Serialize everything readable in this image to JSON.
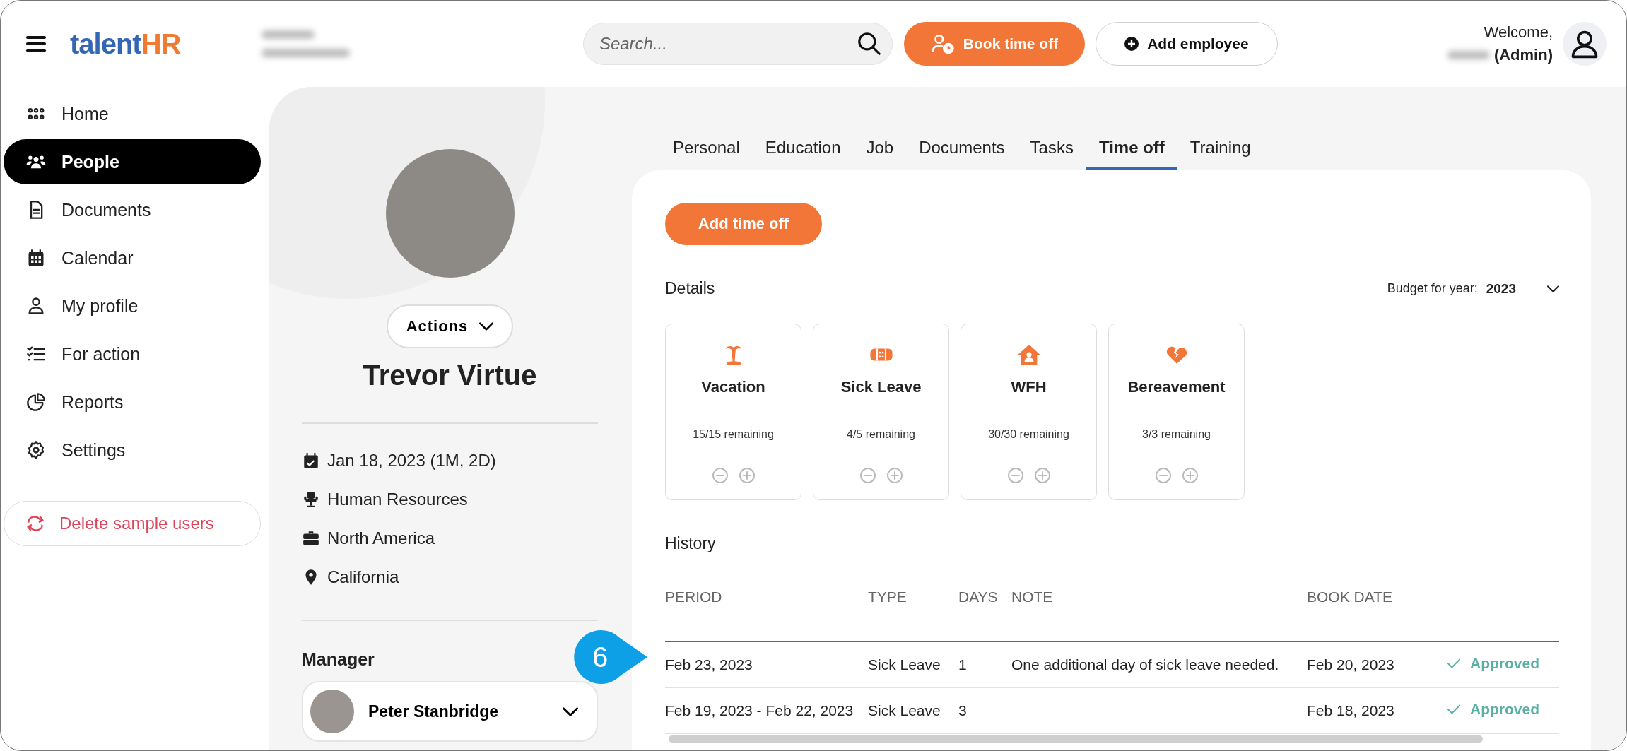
{
  "header": {
    "logo": {
      "part_1": "talent",
      "part_2": "HR"
    },
    "search": {
      "placeholder": "Search..."
    },
    "book_button": "Book time off",
    "add_button": "Add employee",
    "welcome": "Welcome,",
    "role": "(Admin)"
  },
  "sidebar": {
    "items": [
      {
        "label": "Home",
        "selected": false
      },
      {
        "label": "People",
        "selected": true
      },
      {
        "label": "Documents",
        "selected": false
      },
      {
        "label": "Calendar",
        "selected": false
      },
      {
        "label": "My profile",
        "selected": false
      },
      {
        "label": "For action",
        "selected": false
      },
      {
        "label": "Reports",
        "selected": false
      },
      {
        "label": "Settings",
        "selected": false
      }
    ],
    "delete_button": "Delete sample users"
  },
  "profile": {
    "actions_button": "Actions",
    "name": "Trevor Virtue",
    "facts": [
      {
        "text": "Jan 18, 2023 (1M, 2D)"
      },
      {
        "text": "Human Resources"
      },
      {
        "text": "North America"
      },
      {
        "text": "California"
      }
    ],
    "manager_heading": "Manager",
    "manager": "Peter Stanbridge"
  },
  "tabs": [
    {
      "label": "Personal",
      "selected": false
    },
    {
      "label": "Education",
      "selected": false
    },
    {
      "label": "Job",
      "selected": false
    },
    {
      "label": "Documents",
      "selected": false
    },
    {
      "label": "Tasks",
      "selected": false
    },
    {
      "label": "Time off",
      "selected": true
    },
    {
      "label": "Training",
      "selected": false
    }
  ],
  "timeoff": {
    "add_button": "Add time off",
    "details_heading": "Details",
    "budget_label": "Budget for year:",
    "budget_year": "2023",
    "balances": [
      {
        "name": "Vacation",
        "remaining": "15/15 remaining"
      },
      {
        "name": "Sick Leave",
        "remaining": "4/5 remaining"
      },
      {
        "name": "WFH",
        "remaining": "30/30 remaining"
      },
      {
        "name": "Bereavement",
        "remaining": "3/3 remaining"
      }
    ],
    "history_heading": "History",
    "columns": [
      "PERIOD",
      "TYPE",
      "DAYS",
      "NOTE",
      "BOOK DATE"
    ],
    "rows": [
      {
        "period": "Feb 23, 2023",
        "type": "Sick Leave",
        "days": "1",
        "note": "One additional day of sick leave needed.",
        "book_date": "Feb 20, 2023",
        "status": "Approved"
      },
      {
        "period": "Feb 19, 2023 - Feb 22, 2023",
        "type": "Sick Leave",
        "days": "3",
        "note": "",
        "book_date": "Feb 18, 2023",
        "status": "Approved"
      }
    ]
  },
  "callout": "6"
}
